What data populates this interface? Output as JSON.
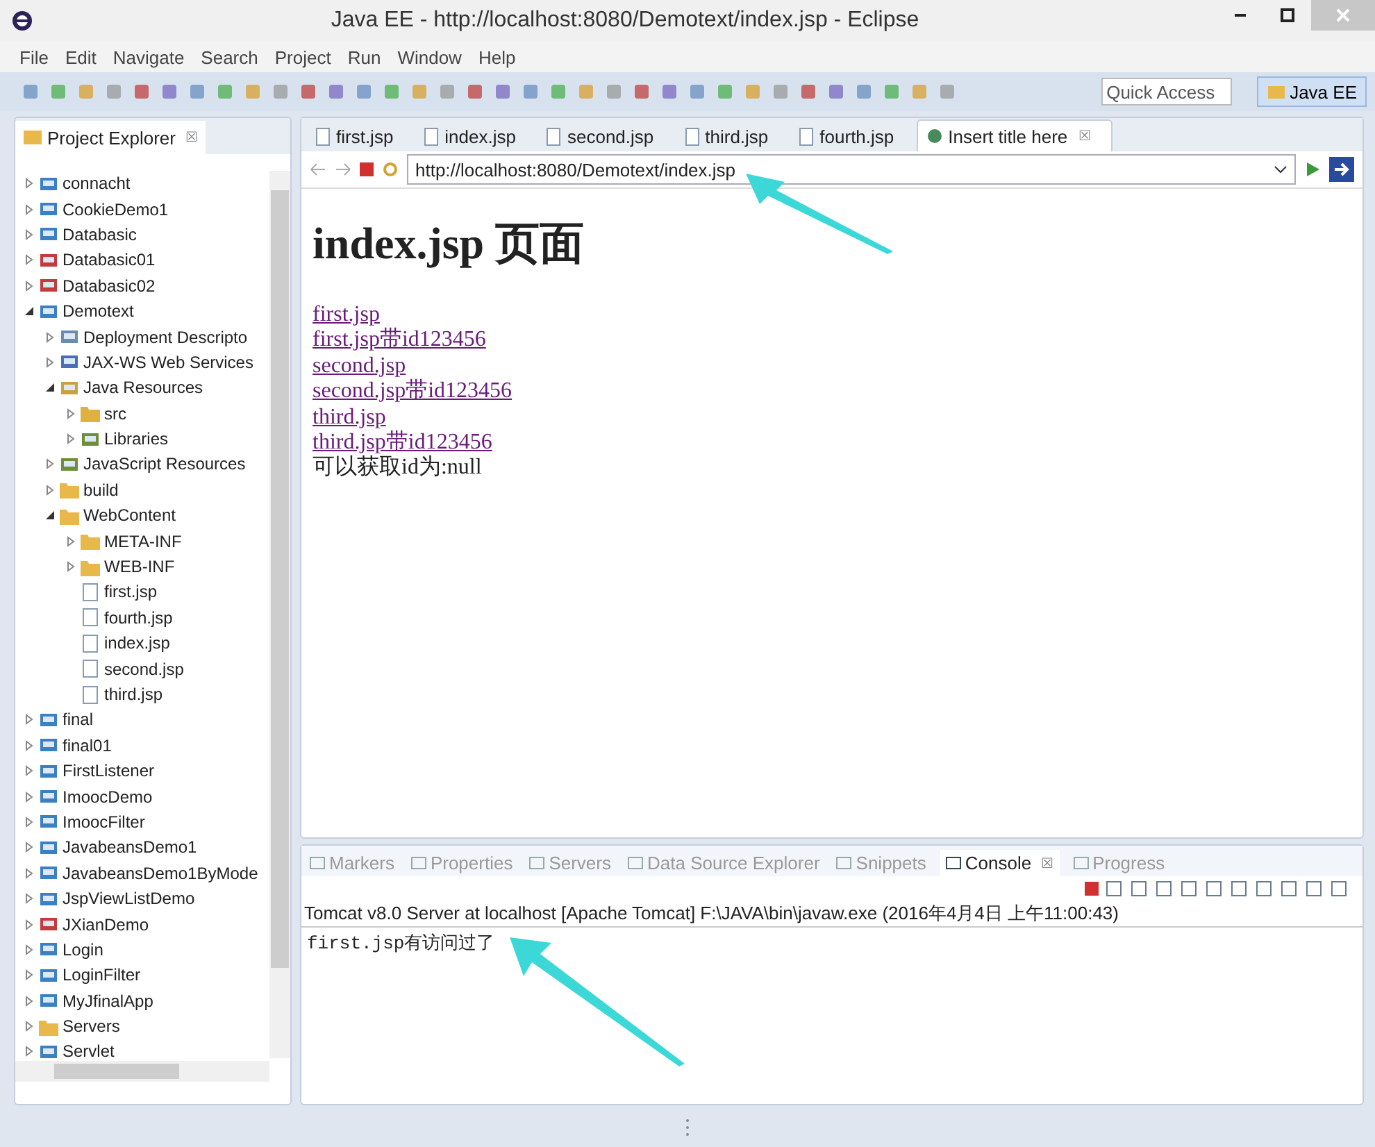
{
  "window": {
    "title": "Java EE - http://localhost:8080/Demotext/index.jsp - Eclipse"
  },
  "menu": [
    "File",
    "Edit",
    "Navigate",
    "Search",
    "Project",
    "Run",
    "Window",
    "Help"
  ],
  "quick_access": {
    "placeholder": "Quick Access"
  },
  "perspective": {
    "label": "Java EE",
    "selected": true
  },
  "explorer": {
    "title": "Project Explorer",
    "close": "☒",
    "tree": [
      {
        "label": "connacht",
        "kind": "project",
        "expanded": false
      },
      {
        "label": "CookieDemo1",
        "kind": "project",
        "expanded": false
      },
      {
        "label": "Databasic",
        "kind": "project",
        "expanded": false
      },
      {
        "label": "Databasic01",
        "kind": "error-project",
        "expanded": false
      },
      {
        "label": "Databasic02",
        "kind": "error-project",
        "expanded": false
      },
      {
        "label": "Demotext",
        "kind": "project",
        "expanded": true,
        "children": [
          {
            "label": "Deployment Descripto",
            "kind": "descriptor",
            "expanded": false
          },
          {
            "label": "JAX-WS Web Services",
            "kind": "services",
            "expanded": false
          },
          {
            "label": "Java Resources",
            "kind": "resources",
            "expanded": true,
            "children": [
              {
                "label": "src",
                "kind": "package-folder",
                "expanded": false
              },
              {
                "label": "Libraries",
                "kind": "library",
                "expanded": false
              }
            ]
          },
          {
            "label": "JavaScript Resources",
            "kind": "library",
            "expanded": false
          },
          {
            "label": "build",
            "kind": "folder",
            "expanded": false
          },
          {
            "label": "WebContent",
            "kind": "folder",
            "expanded": true,
            "children": [
              {
                "label": "META-INF",
                "kind": "folder",
                "expanded": false
              },
              {
                "label": "WEB-INF",
                "kind": "folder",
                "expanded": false
              },
              {
                "label": "first.jsp",
                "kind": "file"
              },
              {
                "label": "fourth.jsp",
                "kind": "file"
              },
              {
                "label": "index.jsp",
                "kind": "file"
              },
              {
                "label": "second.jsp",
                "kind": "file"
              },
              {
                "label": "third.jsp",
                "kind": "file"
              }
            ]
          }
        ]
      },
      {
        "label": "final",
        "kind": "project",
        "expanded": false
      },
      {
        "label": "final01",
        "kind": "project",
        "expanded": false
      },
      {
        "label": "FirstListener",
        "kind": "project",
        "expanded": false
      },
      {
        "label": "ImoocDemo",
        "kind": "project",
        "expanded": false
      },
      {
        "label": "ImoocFilter",
        "kind": "project",
        "expanded": false
      },
      {
        "label": "JavabeansDemo1",
        "kind": "project",
        "expanded": false
      },
      {
        "label": "JavabeansDemo1ByMode",
        "kind": "project",
        "expanded": false
      },
      {
        "label": "JspViewListDemo",
        "kind": "project",
        "expanded": false
      },
      {
        "label": "JXianDemo",
        "kind": "error-project",
        "expanded": false
      },
      {
        "label": "Login",
        "kind": "project",
        "expanded": false
      },
      {
        "label": "LoginFilter",
        "kind": "project",
        "expanded": false
      },
      {
        "label": "MyJfinalApp",
        "kind": "project",
        "expanded": false
      },
      {
        "label": "Servers",
        "kind": "folder",
        "expanded": false
      },
      {
        "label": "Servlet",
        "kind": "project",
        "expanded": false
      }
    ]
  },
  "editor_tabs": [
    {
      "label": "first.jsp",
      "kind": "file",
      "selected": false
    },
    {
      "label": "index.jsp",
      "kind": "file",
      "selected": false
    },
    {
      "label": "second.jsp",
      "kind": "file",
      "selected": false
    },
    {
      "label": "third.jsp",
      "kind": "file",
      "selected": false
    },
    {
      "label": "fourth.jsp",
      "kind": "file",
      "selected": false
    },
    {
      "label": "Insert title here",
      "kind": "browser",
      "selected": true,
      "close": "☒"
    }
  ],
  "browser": {
    "url": "http://localhost:8080/Demotext/index.jsp",
    "heading": "index.jsp 页面",
    "lines": [
      {
        "kind": "link",
        "text": "first.jsp"
      },
      {
        "kind": "link",
        "text": "first.jsp带id123456"
      },
      {
        "kind": "link",
        "text": "second.jsp"
      },
      {
        "kind": "link",
        "text": "second.jsp带id123456"
      },
      {
        "kind": "link",
        "text": "third.jsp"
      },
      {
        "kind": "link",
        "text": "third.jsp带id123456"
      },
      {
        "kind": "text",
        "text": "可以获取id为:null"
      }
    ]
  },
  "bottom_tabs": [
    {
      "label": "Markers",
      "selected": false
    },
    {
      "label": "Properties",
      "selected": false
    },
    {
      "label": "Servers",
      "selected": false
    },
    {
      "label": "Data Source Explorer",
      "selected": false
    },
    {
      "label": "Snippets",
      "selected": false
    },
    {
      "label": "Console",
      "selected": true,
      "close": "☒"
    },
    {
      "label": "Progress",
      "selected": false
    }
  ],
  "console": {
    "header": "Tomcat v8.0 Server at localhost [Apache Tomcat] F:\\JAVA\\bin\\javaw.exe (2016年4月4日 上午11:00:43)",
    "output": [
      "first.jsp有访问过了"
    ]
  }
}
